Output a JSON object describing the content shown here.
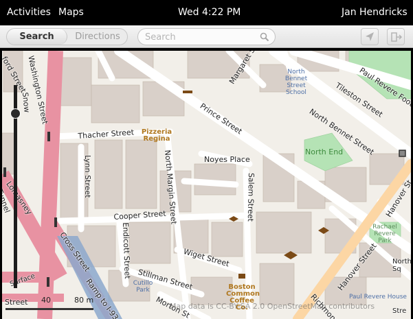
{
  "topbar": {
    "activities": "Activities",
    "app_name": "Maps",
    "clock": "Wed 4:22 PM",
    "user": "Jan Hendricks"
  },
  "toolbar": {
    "tab_search": "Search",
    "tab_directions": "Directions",
    "search_placeholder": "Search",
    "search_value": "",
    "icons": [
      "search-icon",
      "locate-icon",
      "exit-icon"
    ]
  },
  "map": {
    "streets": {
      "washington": "Washington Street",
      "thacher": "Thacher Street",
      "lynn": "Lynn Street",
      "north_margin": "North Margin Street",
      "noyes": "Noyes Place",
      "salem": "Salem Street",
      "cooper": "Cooper Street",
      "endicott": "Endicott Street",
      "cross": "Cross Street",
      "wiget": "Wiget Street",
      "stillman": "Stillman Street",
      "morton": "Morton St",
      "hanover_1": "Hanover Street",
      "hanover_2": "Hanover St",
      "prince": "Prince Street",
      "margaret": "Margaret Street",
      "tileston": "Tileston Street",
      "north_bennet": "North Bennet Street",
      "paul_revere_footpath": "Paul Revere Footpath",
      "richmond": "Richmond",
      "ramp": "Ramp to I-93",
      "tunnel": "Tunnel",
      "snow": "Snow",
      "lomasney": "Lomasney",
      "rd_street": "ford Street",
      "corner_street": "Street",
      "north_sq": "North Sq",
      "surface": "Surface",
      "paul_revere_house": "Paul Revere House",
      "e_label": "Stre"
    },
    "pois": {
      "school": "North Bennet Street School",
      "pizzeria": "Pizzeria Regina",
      "north_end": "North End",
      "rachael_revere": "Rachael Revere Park",
      "boston_common_coffee": "Boston Common Coffee Co.",
      "cutillo": "Cutillo Park",
      "paul_revere_house": "Paul Revere House",
      "north_square": "North Square"
    },
    "scale": {
      "label_40": "40",
      "label_80": "80 m"
    },
    "attribution": "Map data is CC-BY-SA 2.0 OpenStreetMap contributors",
    "zoom_level_fraction": 0.12,
    "colors": {
      "background": "#f2efe9",
      "building": "#d9d0c9",
      "building_dark": "#c9bcb1",
      "road": "#ffffff",
      "highway": "#e892a2",
      "primary": "#fcd6a4",
      "park": "#b5e3b5",
      "water_ramp": "#8ca8cc"
    }
  }
}
